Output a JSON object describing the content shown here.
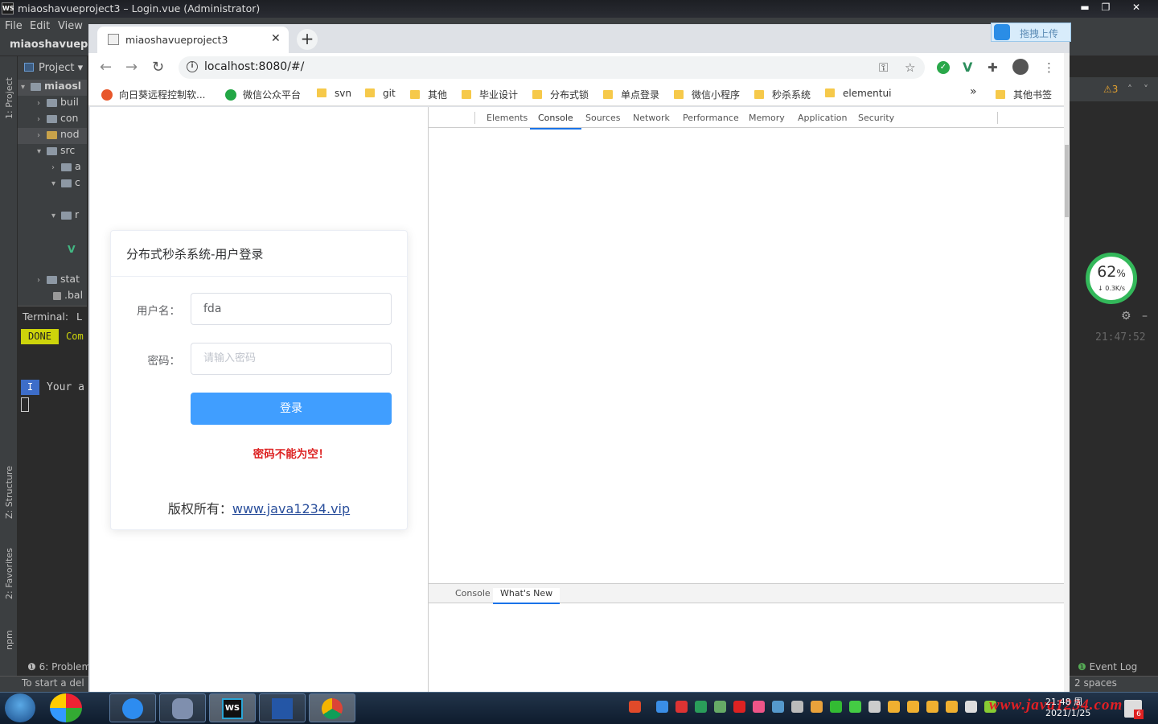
{
  "ide": {
    "title_icon": "WS",
    "window_title": "miaoshavueproject3 – Login.vue (Administrator)",
    "menu": [
      "File",
      "Edit",
      "View"
    ],
    "project_name": "miaoshavuepro",
    "project_header": "Project",
    "sidebar_labels": {
      "project": "1: Project",
      "structure": "Z: Structure",
      "favorites": "2: Favorites",
      "npm": "npm"
    },
    "tree": [
      {
        "arrow": "▾",
        "label": "miaosl"
      },
      {
        "arrow": "›",
        "label": "buil"
      },
      {
        "arrow": "›",
        "label": "con"
      },
      {
        "arrow": "›",
        "label": "nod"
      },
      {
        "arrow": "▾",
        "label": "src"
      },
      {
        "arrow": "›",
        "label": "a"
      },
      {
        "arrow": "▾",
        "label": "c"
      },
      {
        "arrow": "▾",
        "label": "r"
      },
      {
        "arrow": "›",
        "label": "stat"
      },
      {
        "arrow": "",
        "label": ".bal"
      }
    ],
    "terminal_label": "Terminal:",
    "terminal_tab": "L",
    "done_badge": "DONE",
    "done_text": "Com",
    "info_badge": "I",
    "info_text": "Your a",
    "problems": "6: Problem",
    "status_text": "To start a del",
    "warning_count": "3",
    "timestamp": "21:47:52",
    "event_log": "Event Log",
    "indent": "2 spaces"
  },
  "speed_widget": {
    "percent": "62",
    "unit": "%",
    "rate": "0.3K/s"
  },
  "baidu_widget": {
    "text": "拖拽上传"
  },
  "browser": {
    "tab_title": "miaoshavueproject3",
    "url": "localhost:8080/#/",
    "bookmarks": [
      {
        "label": "向日葵远程控制软...",
        "kind": "dot",
        "color": "#e8572b"
      },
      {
        "label": "微信公众平台",
        "kind": "dot",
        "color": "#22a745"
      },
      {
        "label": "svn",
        "kind": "folder"
      },
      {
        "label": "git",
        "kind": "folder"
      },
      {
        "label": "其他",
        "kind": "folder"
      },
      {
        "label": "毕业设计",
        "kind": "folder"
      },
      {
        "label": "分布式锁",
        "kind": "folder"
      },
      {
        "label": "单点登录",
        "kind": "folder"
      },
      {
        "label": "微信小程序",
        "kind": "folder"
      },
      {
        "label": "秒杀系统",
        "kind": "folder"
      },
      {
        "label": "elementui",
        "kind": "folder"
      }
    ],
    "more_bookmarks": "»",
    "other_bookmarks": "其他书签"
  },
  "login": {
    "title": "分布式秒杀系统-用户登录",
    "username_label": "用户名：",
    "username_value": "fda",
    "password_label": "密码：",
    "password_placeholder": "请输入密码",
    "login_button": "登录",
    "error": "密码不能为空！",
    "copyright_prefix": "版权所有：",
    "copyright_link": "www.java1234.vip"
  },
  "devtools": {
    "tabs": [
      "Elements",
      "Console",
      "Sources",
      "Network",
      "Performance",
      "Memory",
      "Application",
      "Security"
    ],
    "active_tab": "Console",
    "drawer_tabs": [
      "Console",
      "What's New"
    ],
    "drawer_active": "What's New"
  },
  "taskbar": {
    "time": "21:48 周",
    "date": "2021/1/25",
    "watermark": "www.java1234.com",
    "notification_count": "6"
  }
}
